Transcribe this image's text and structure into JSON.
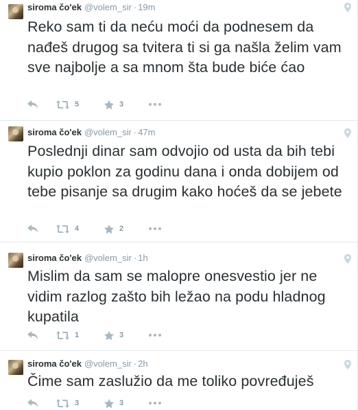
{
  "colors": {
    "text": "#292f33",
    "muted": "#8899a6",
    "divider": "#e1e8ed"
  },
  "tweets": [
    {
      "name": "siroma čo'ek",
      "handle": "@volem_sir",
      "dot": "·",
      "time": "19m",
      "text": "Reko sam ti da neću moći da podnesem da nađeš drugog sa tvitera ti si ga našla želim vam sve najbolje a sa mnom šta bude biće ćao",
      "retweets": "5",
      "favorites": "3"
    },
    {
      "name": "siroma čo'ek",
      "handle": "@volem_sir",
      "dot": "·",
      "time": "47m",
      "text": "Poslednji dinar sam odvojio od usta da bih tebi kupio poklon za godinu dana i onda dobijem od tebe pisanje sa drugim kako hoćeš da se jebete",
      "retweets": "4",
      "favorites": "2"
    },
    {
      "name": "siroma čo'ek",
      "handle": "@volem_sir",
      "dot": "·",
      "time": "1h",
      "text": "Mislim da sam se malopre onesvestio jer ne vidim razlog zašto bih ležao na podu hladnog kupatila",
      "retweets": "1",
      "favorites": "3"
    },
    {
      "name": "siroma čo'ek",
      "handle": "@volem_sir",
      "dot": "·",
      "time": "2h",
      "text": "Čime sam zaslužio da me toliko povređuješ",
      "retweets": "3",
      "favorites": "3"
    }
  ],
  "icons": {
    "avatar": "user-avatar",
    "location": "location-pin-icon",
    "reply": "reply-icon",
    "retweet": "retweet-icon",
    "favorite": "star-icon",
    "more": "more-dots-icon"
  }
}
